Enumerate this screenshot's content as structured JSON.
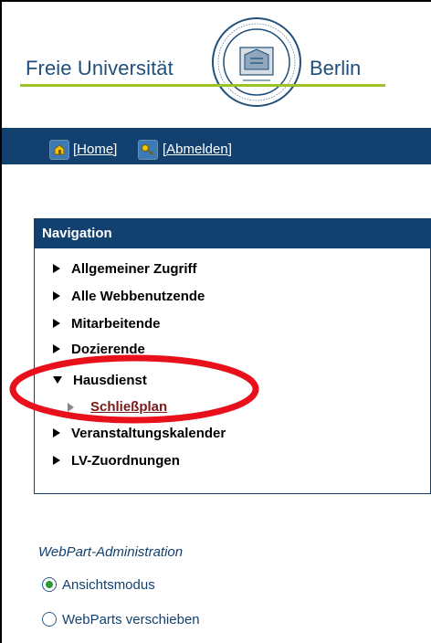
{
  "header": {
    "uni_left": "Freie Universität",
    "uni_right": "Berlin",
    "seal_text_top": "VERITAS IUSTITIA LIBERTAS",
    "seal_text_bottom": "FREIE UNIVERSITÄT BERLIN"
  },
  "topbar": {
    "home_label": "[Home]",
    "logout_label": "[Abmelden]"
  },
  "navigation": {
    "title": "Navigation",
    "items": [
      {
        "label": "Allgemeiner Zugriff",
        "expanded": false
      },
      {
        "label": "Alle Webbenutzende",
        "expanded": false
      },
      {
        "label": "Mitarbeitende",
        "expanded": false
      },
      {
        "label": "Dozierende",
        "expanded": false
      },
      {
        "label": "Hausdienst",
        "expanded": true
      },
      {
        "label": "Veranstaltungskalender",
        "expanded": false
      },
      {
        "label": "LV-Zuordnungen",
        "expanded": false
      }
    ],
    "subitem": {
      "label": "Schließplan",
      "parent": "Hausdienst"
    }
  },
  "webpart": {
    "title": "WebPart-Administration",
    "options": [
      {
        "label": "Ansichtsmodus",
        "selected": true
      },
      {
        "label": "WebParts verschieben",
        "selected": false
      }
    ]
  },
  "colors": {
    "brand_blue": "#13416f",
    "accent_green": "#9cc428",
    "annotation_red": "#e8101a",
    "subitem_red": "#7a1a1a"
  }
}
